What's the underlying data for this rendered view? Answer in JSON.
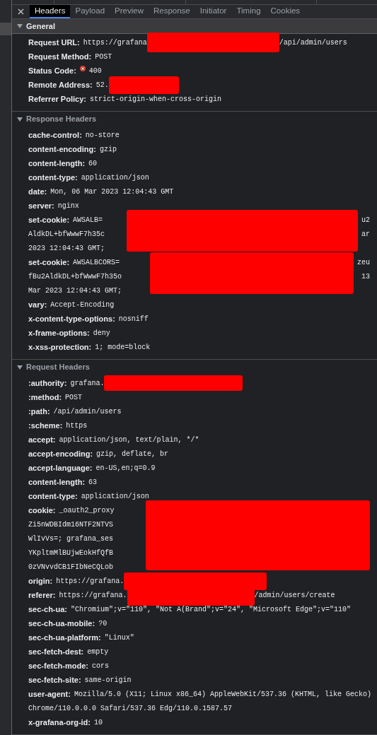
{
  "tabs": [
    {
      "label": "Headers",
      "selected": true
    },
    {
      "label": "Payload",
      "selected": false
    },
    {
      "label": "Preview",
      "selected": false
    },
    {
      "label": "Response",
      "selected": false
    },
    {
      "label": "Initiator",
      "selected": false
    },
    {
      "label": "Timing",
      "selected": false
    },
    {
      "label": "Cookies",
      "selected": false
    }
  ],
  "sections": [
    {
      "title": "General",
      "highlighted": true,
      "expanded": true,
      "rows": [
        {
          "name": "Request URL:",
          "value": "https://grafana",
          "redacted": true,
          "after": "/api/admin/users"
        },
        {
          "name": "Request Method:",
          "value": "POST"
        },
        {
          "name": "Status Code:",
          "value": "400",
          "error": true
        },
        {
          "name": "Remote Address:",
          "value": "52.",
          "redacted": true
        },
        {
          "name": "Referrer Policy:",
          "value": "strict-origin-when-cross-origin"
        }
      ]
    },
    {
      "title": "Response Headers",
      "highlighted": false,
      "expanded": true,
      "rows": [
        {
          "name": "cache-control:",
          "value": "no-store"
        },
        {
          "name": "content-encoding:",
          "value": "gzip"
        },
        {
          "name": "content-length:",
          "value": "60"
        },
        {
          "name": "content-type:",
          "value": "application/json"
        },
        {
          "name": "date:",
          "value": "Mon, 06 Mar 2023 12:04:43 GMT"
        },
        {
          "name": "server:",
          "value": "nginx"
        },
        {
          "name": "set-cookie:",
          "lines": [
            {
              "text": "AWSALB=",
              "tail": "u2"
            },
            {
              "text": "AldkDL+bfWwwF7h35c",
              "tail": "ar"
            },
            {
              "text": "2023 12:04:43 GMT;"
            }
          ],
          "redacted": true
        },
        {
          "name": "set-cookie:",
          "lines": [
            {
              "text": "AWSALBCORS=",
              "tail": "zeu"
            },
            {
              "text": "fBu2AldkDL+bfWwwF7h35o",
              "tail": "13"
            },
            {
              "text": "Mar 2023 12:04:43 GMT;"
            }
          ],
          "redacted": true
        },
        {
          "name": "vary:",
          "value": "Accept-Encoding"
        },
        {
          "name": "x-content-type-options:",
          "value": "nosniff"
        },
        {
          "name": "x-frame-options:",
          "value": "deny"
        },
        {
          "name": "x-xss-protection:",
          "value": "1; mode=block"
        }
      ]
    },
    {
      "title": "Request Headers",
      "highlighted": false,
      "expanded": true,
      "rows": [
        {
          "name": ":authority:",
          "value": "grafana.",
          "redacted": true
        },
        {
          "name": ":method:",
          "value": "POST"
        },
        {
          "name": ":path:",
          "value": "/api/admin/users"
        },
        {
          "name": ":scheme:",
          "value": "https"
        },
        {
          "name": "accept:",
          "value": "application/json, text/plain, */*"
        },
        {
          "name": "accept-encoding:",
          "value": "gzip, deflate, br"
        },
        {
          "name": "accept-language:",
          "value": "en-US,en;q=0.9"
        },
        {
          "name": "content-length:",
          "value": "63"
        },
        {
          "name": "content-type:",
          "value": "application/json"
        },
        {
          "name": "cookie:",
          "lines": [
            {
              "text": "_oauth2_proxy"
            },
            {
              "text": "Zi5nWDBIdm16NTF2NTVS"
            },
            {
              "text": "WlIvVs=; grafana_ses"
            },
            {
              "text": "YKpltmMlBUjwEokHfQfB"
            },
            {
              "text": "0zVNvvdCB1FIbNeCQLob"
            }
          ],
          "redacted": true
        },
        {
          "name": "origin:",
          "value": "https://grafana.",
          "redacted": true
        },
        {
          "name": "referer:",
          "value": "https://grafana.",
          "redacted": true,
          "after": "/admin/users/create"
        },
        {
          "name": "sec-ch-ua:",
          "value": "\"Chromium\";v=\"110\", \"Not A(Brand\";v=\"24\", \"Microsoft Edge\";v=\"110\""
        },
        {
          "name": "sec-ch-ua-mobile:",
          "value": "?0"
        },
        {
          "name": "sec-ch-ua-platform:",
          "value": "\"Linux\""
        },
        {
          "name": "sec-fetch-dest:",
          "value": "empty"
        },
        {
          "name": "sec-fetch-mode:",
          "value": "cors"
        },
        {
          "name": "sec-fetch-site:",
          "value": "same-origin"
        },
        {
          "name": "user-agent:",
          "lines": [
            {
              "text": "Mozilla/5.0 (X11; Linux x86_64) AppleWebKit/537.36 (KHTML, like Gecko)"
            },
            {
              "text": "Chrome/110.0.0.0 Safari/537.36 Edg/110.0.1587.57"
            }
          ]
        },
        {
          "name": "x-grafana-org-id:",
          "value": "10"
        }
      ]
    }
  ]
}
